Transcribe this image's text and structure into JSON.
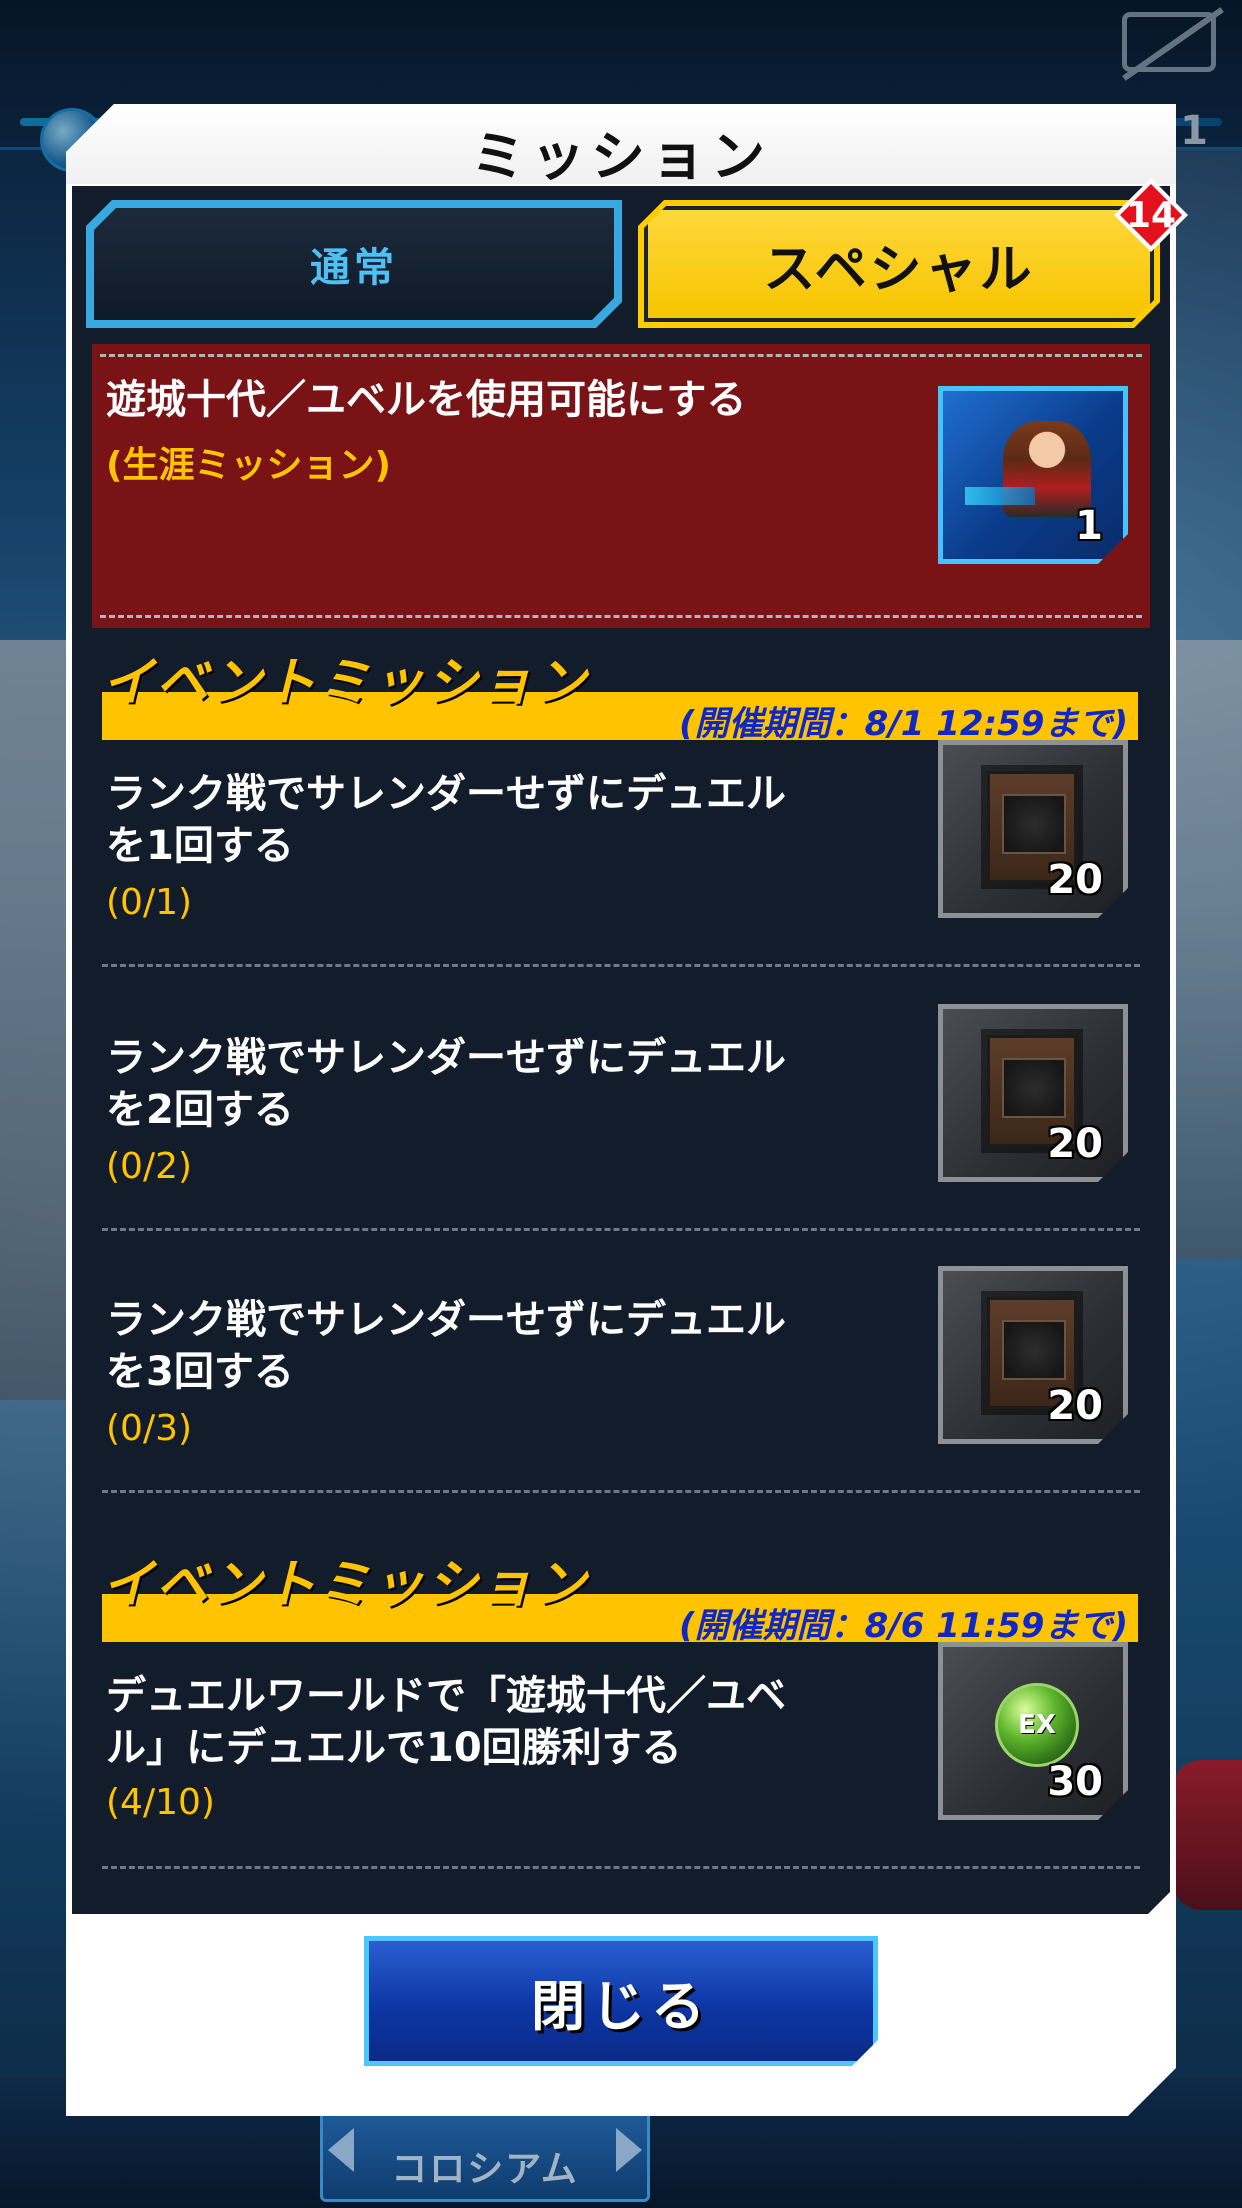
{
  "background": {
    "top_right_count": "1",
    "bottom_nav_label": "コロシアム"
  },
  "modal": {
    "title": "ミッション",
    "tabs": {
      "normal": "通常",
      "special": "スペシャル",
      "special_badge": "14",
      "active": "special"
    },
    "life_mission": {
      "title": "遊城十代／ユベルを使用可能にする",
      "subtitle": "(生涯ミッション)",
      "reward_count": "1",
      "reward_icon": "character-avatar-icon"
    },
    "event_groups": [
      {
        "header": "イベントミッション",
        "period": "(開催期間：8/1 12:59まで)",
        "missions": [
          {
            "title_line1": "ランク戦でサレンダーせずにデュエル",
            "title_line2": "を1回する",
            "progress": "(0/1)",
            "reward_icon": "card-pack-icon",
            "reward_count": "20"
          },
          {
            "title_line1": "ランク戦でサレンダーせずにデュエル",
            "title_line2": "を2回する",
            "progress": "(0/2)",
            "reward_icon": "card-pack-icon",
            "reward_count": "20"
          },
          {
            "title_line1": "ランク戦でサレンダーせずにデュエル",
            "title_line2": "を3回する",
            "progress": "(0/3)",
            "reward_icon": "card-pack-icon",
            "reward_count": "20"
          }
        ]
      },
      {
        "header": "イベントミッション",
        "period": "(開催期間：8/6 11:59まで)",
        "missions": [
          {
            "title_line1": "デュエルワールドで「遊城十代／ユベ",
            "title_line2": "ル」にデュエルで10回勝利する",
            "progress": "(4/10)",
            "reward_icon": "ex-orb-icon",
            "reward_orb_text": "EX",
            "reward_count": "30"
          }
        ]
      }
    ],
    "close_button": "閉じる"
  },
  "colors": {
    "accent_yellow": "#ffc300",
    "life_mission_bg": "#7a1316",
    "panel_bg": "#121c2b",
    "tab_normal_text": "#4fc0f3",
    "period_text": "#0f27c7",
    "badge_red": "#e3101e"
  }
}
